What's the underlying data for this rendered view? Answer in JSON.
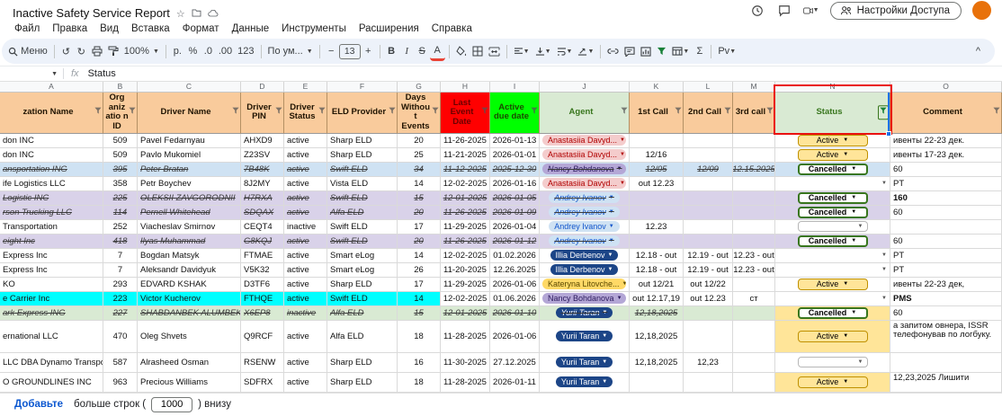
{
  "titlebar": {
    "title": "Inactive Safety Service Report",
    "share_button": "Настройки Доступа"
  },
  "menubar": {
    "items": [
      "Файл",
      "Правка",
      "Вид",
      "Вставка",
      "Формат",
      "Данные",
      "Инструменты",
      "Расширения",
      "Справка"
    ]
  },
  "toolbar": {
    "menu_label": "Меню",
    "zoom": "100%",
    "currency": "р.",
    "percent": "%",
    "dec_less": ".0",
    "dec_more": ".00",
    "fmt123": "123",
    "font_name": "По ум...",
    "minus": "−",
    "font_size": "13",
    "plus": "+",
    "bold": "B",
    "italic": "I",
    "strike": "S",
    "text_color": "A",
    "sum": "Σ",
    "pv": "Pv",
    "collapse": "^"
  },
  "formula_bar": {
    "name_box": "",
    "fx": "fx",
    "value": "Status"
  },
  "sheet": {
    "colors": {
      "header_bg": "#f9cb9c",
      "last_event_bg": "#ff0000",
      "due_bg": "#00ff00",
      "green_header_bg": "#d9ead3",
      "green_header_fg": "#38761d",
      "annotation_red": "#ea1010",
      "selection_blue": "#1a73e8",
      "row_purple": "#d9d2e9",
      "row_bluegray": "#cfe2f3",
      "row_green": "#d9ead3",
      "row_cyan": "#00ffff",
      "status_cell_yellow": "#ffe599"
    },
    "columns": [
      {
        "key": "org",
        "letter": "A",
        "label": "zation Name",
        "header_bg": "#f9cb9c",
        "header_fg": "#1f1300"
      },
      {
        "key": "org_id",
        "letter": "B",
        "label": "Org aniz atio n ID",
        "header_bg": "#f9cb9c",
        "header_fg": "#1f1300"
      },
      {
        "key": "driver_name",
        "letter": "C",
        "label": "Driver Name",
        "header_bg": "#f9cb9c",
        "header_fg": "#1f1300"
      },
      {
        "key": "driver_pin",
        "letter": "D",
        "label": "Driver PIN",
        "header_bg": "#f9cb9c",
        "header_fg": "#1f1300"
      },
      {
        "key": "driver_status",
        "letter": "E",
        "label": "Driver Status",
        "header_bg": "#f9cb9c",
        "header_fg": "#1f1300"
      },
      {
        "key": "eld",
        "letter": "F",
        "label": "ELD Provider",
        "header_bg": "#f9cb9c",
        "header_fg": "#1f1300"
      },
      {
        "key": "days",
        "letter": "G",
        "label": "Days Withou t Events",
        "header_bg": "#f9cb9c",
        "header_fg": "#1f1300"
      },
      {
        "key": "last_event",
        "letter": "H",
        "label": "Last Event Date",
        "header_bg": "#ff0000",
        "header_fg": "#6a0000"
      },
      {
        "key": "due",
        "letter": "I",
        "label": "Active due date",
        "header_bg": "#00ff00",
        "header_fg": "#1a4a00"
      },
      {
        "key": "agent",
        "letter": "J",
        "label": "Agent",
        "header_bg": "#d9ead3",
        "header_fg": "#38761d"
      },
      {
        "key": "call1",
        "letter": "K",
        "label": "1st Call",
        "header_bg": "#f9cb9c",
        "header_fg": "#1f1300"
      },
      {
        "key": "call2",
        "letter": "L",
        "label": "2nd Call",
        "header_bg": "#f9cb9c",
        "header_fg": "#1f1300"
      },
      {
        "key": "call3",
        "letter": "M",
        "label": "3rd call",
        "header_bg": "#f9cb9c",
        "header_fg": "#1f1300"
      },
      {
        "key": "status",
        "letter": "N",
        "label": "Status",
        "header_bg": "#d9ead3",
        "header_fg": "#38761d"
      },
      {
        "key": "comment",
        "letter": "O",
        "label": "Comment",
        "header_bg": "#f9cb9c",
        "header_fg": "#1f1300"
      }
    ],
    "agent_styles": {
      "Anastasiia Davyd...": {
        "bg": "#f4cccc",
        "fg": "#b10202"
      },
      "Nancy Bohdanova": {
        "bg": "#b4a7d6",
        "fg": "#2c1a5e"
      },
      "Andrey Ivanov": {
        "bg": "#cfe2f3",
        "fg": "#1155cc"
      },
      "Illia Derbenov": {
        "bg": "#1c4587",
        "fg": "#ffffff"
      },
      "Kateryna Litovche...": {
        "bg": "#ffd966",
        "fg": "#5b4a00"
      },
      "Yurii Taran": {
        "bg": "#1c4587",
        "fg": "#ffffff"
      }
    },
    "status_styles": {
      "Active": {
        "bg": "#ffe599",
        "border": "#bf9000",
        "fg": "#000000",
        "bold": false
      },
      "Cancelled": {
        "bg": "#ffffff",
        "border": "#38761d",
        "fg": "#000000",
        "bold": true
      }
    },
    "rows": [
      {
        "org": "don INC",
        "org_id": "509",
        "driver_name": "Pavel Fedarnyau",
        "driver_pin": "AHXD9",
        "driver_status": "active",
        "eld": "Sharp ELD",
        "days": "20",
        "last_event": "11-26-2025",
        "due": "2026-01-13",
        "agent": "Anastasiia Davyd...",
        "call1": "",
        "call2": "",
        "call3": "",
        "status": "Active",
        "comment": "ивенты 22-23 дек."
      },
      {
        "org": "don INC",
        "org_id": "509",
        "driver_name": "Pavlo Mukomiel",
        "driver_pin": "Z23SV",
        "driver_status": "active",
        "eld": "Sharp ELD",
        "days": "25",
        "last_event": "11-21-2025",
        "due": "2026-01-01",
        "agent": "Anastasiia Davyd...",
        "call1": "12/16",
        "call2": "",
        "call3": "",
        "status": "Active",
        "comment": "ивенты 17-23 дек."
      },
      {
        "org": "ansportation ING",
        "org_id": "395",
        "driver_name": "Peter Bratan",
        "driver_pin": "7B48K",
        "driver_status": "active",
        "eld": "Swift ELD",
        "days": "34",
        "last_event": "11-12-2025",
        "due": "2025-12-30",
        "agent": "Nancy Bohdanova",
        "call1": "12/05",
        "call2": "12/09",
        "call3": "12.15.2025",
        "status": "Cancelled",
        "comment": "60",
        "struck": true,
        "bg": "#cfe2f3"
      },
      {
        "org": "ife Logistics LLC",
        "org_id": "358",
        "driver_name": "Petr Boychev",
        "driver_pin": "8J2MY",
        "driver_status": "active",
        "eld": "Vista ELD",
        "days": "14",
        "last_event": "12-02-2025",
        "due": "2026-01-16",
        "agent": "Anastasiia Davyd...",
        "call1": "out 12.23",
        "call2": "",
        "call3": "",
        "status": "",
        "comment": "PT"
      },
      {
        "org": "Logistic INC",
        "org_id": "225",
        "driver_name": "OLEKSII ZAVGORODNII",
        "driver_pin": "H7RXA",
        "driver_status": "active",
        "eld": "Swift ELD",
        "days": "15",
        "last_event": "12-01-2025",
        "due": "2026-01-05",
        "agent": "Andrey Ivanov",
        "call1": "",
        "call2": "",
        "call3": "",
        "status": "Cancelled",
        "comment": "160",
        "comment_bold": true,
        "struck": true,
        "bg": "#d9d2e9"
      },
      {
        "org": "rson Trucking LLC",
        "org_id": "114",
        "driver_name": "Pernell Whitehead",
        "driver_pin": "SDQAX",
        "driver_status": "active",
        "eld": "Alfa ELD",
        "days": "20",
        "last_event": "11-26-2025",
        "due": "2026-01-09",
        "agent": "Andrey Ivanov",
        "call1": "",
        "call2": "",
        "call3": "",
        "status": "Cancelled",
        "comment": "60",
        "struck": true,
        "bg": "#d9d2e9"
      },
      {
        "org": "Transportation",
        "org_id": "252",
        "driver_name": "Viacheslav Smirnov",
        "driver_pin": "CEQT4",
        "driver_status": "inactive",
        "eld": "Swift ELD",
        "days": "17",
        "last_event": "11-29-2025",
        "due": "2026-01-04",
        "agent": "Andrey Ivanov",
        "call1": "12.23",
        "call2": "",
        "call3": "",
        "status": "",
        "status_pill": true,
        "comment": ""
      },
      {
        "org": "eight Inc",
        "org_id": "418",
        "driver_name": "Ilyas Muhammad",
        "driver_pin": "G8KQJ",
        "driver_status": "active",
        "eld": "Swift ELD",
        "days": "20",
        "last_event": "11-26-2025",
        "due": "2026-01-12",
        "agent": "Andrey Ivanov",
        "call1": "",
        "call2": "",
        "call3": "",
        "status": "Cancelled",
        "comment": "60",
        "struck": true,
        "bg": "#d9d2e9"
      },
      {
        "org": "Express Inc",
        "org_id": "7",
        "driver_name": "Bogdan Matsyk",
        "driver_pin": "FTMAE",
        "driver_status": "active",
        "eld": "Smart eLog",
        "days": "14",
        "last_event": "12-02-2025",
        "due": "01.02.2026",
        "agent": "Illia Derbenov",
        "call1": "12.18 - out",
        "call2": "12.19 - out",
        "call3": "12.23 - out",
        "status": "",
        "comment": "PT"
      },
      {
        "org": "Express Inc",
        "org_id": "7",
        "driver_name": "Aleksandr Davidyuk",
        "driver_pin": "V5K32",
        "driver_status": "active",
        "eld": "Smart eLog",
        "days": "26",
        "last_event": "11-20-2025",
        "due": "12.26.2025",
        "agent": "Illia Derbenov",
        "call1": "12.18 - out",
        "call2": "12.19 - out",
        "call3": "12.23 - out",
        "status": "",
        "comment": "PT"
      },
      {
        "org": "KO",
        "org_id": "293",
        "driver_name": "EDVARD KSHAK",
        "driver_pin": "D3TF6",
        "driver_status": "active",
        "eld": "Sharp ELD",
        "days": "17",
        "last_event": "11-29-2025",
        "due": "2026-01-06",
        "agent": "Kateryna Litovche...",
        "call1": "out 12/21",
        "call2": "out 12/22",
        "call3": "",
        "status": "Active",
        "comment": "ивенты 22-23 дек,"
      },
      {
        "org": "e Carrier Inc",
        "org_id": "223",
        "driver_name": "Victor Kucherov",
        "driver_pin": "FTHQE",
        "driver_status": "active",
        "eld": "Swift ELD",
        "days": "14",
        "last_event": "12-02-2025",
        "due": "01.06.2026",
        "agent": "Nancy Bohdanova",
        "call1": "out 12.17,19",
        "call2": "out 12.23",
        "call3": "ст",
        "status": "",
        "comment": "PMS",
        "comment_bold": true,
        "bg_left": "#00ffff"
      },
      {
        "org": "ark Express ING",
        "org_id": "227",
        "driver_name": "SHABDANBEK ALUMBEK",
        "driver_pin": "X6EP8",
        "driver_status": "inactive",
        "eld": "Alfa ELD",
        "days": "15",
        "last_event": "12-01-2025",
        "due": "2026-01-10",
        "agent": "Yurii Taran",
        "call1": "12,18,2025",
        "call2": "",
        "call3": "",
        "status": "Cancelled",
        "comment": "60",
        "struck": true,
        "bg": "#d9ead3",
        "status_bg": "#ffe599"
      },
      {
        "org": "ernational LLC",
        "org_id": "470",
        "driver_name": "Oleg Shvets",
        "driver_pin": "Q9RCF",
        "driver_status": "active",
        "eld": "Alfa ELD",
        "days": "18",
        "last_event": "11-28-2025",
        "due": "2026-01-06",
        "agent": "Yurii Taran",
        "call1": "12,18,2025",
        "call2": "",
        "call3": "",
        "status": "Active",
        "comment": "а запитом овнера, ISSR телефонував по логбуку.",
        "status_bg": "#ffe599"
      },
      {
        "org": "LLC DBA Dynamo Transport",
        "org_id": "587",
        "driver_name": "Alrasheed Osman",
        "driver_pin": "RSENW",
        "driver_status": "active",
        "eld": "Sharp ELD",
        "days": "16",
        "last_event": "11-30-2025",
        "due": "27.12.2025",
        "agent": "Yurii Taran",
        "call1": "12,18,2025",
        "call2": "12,23",
        "call3": "",
        "status": "",
        "status_pill": true,
        "comment": ""
      },
      {
        "org": "O GROUNDLINES INC",
        "org_id": "963",
        "driver_name": "Precious Williams",
        "driver_pin": "SDFRX",
        "driver_status": "active",
        "eld": "Sharp ELD",
        "days": "18",
        "last_event": "11-28-2025",
        "due": "2026-01-11",
        "agent": "Yurii Taran",
        "call1": "",
        "call2": "",
        "call3": "",
        "status": "Active",
        "comment": "12,23,2025 Лишити",
        "status_bg": "#ffe599"
      }
    ]
  },
  "footer": {
    "add_label": "Добавьте",
    "more_prefix": "больше строк (",
    "rows_value": "1000",
    "more_suffix": ") внизу"
  }
}
